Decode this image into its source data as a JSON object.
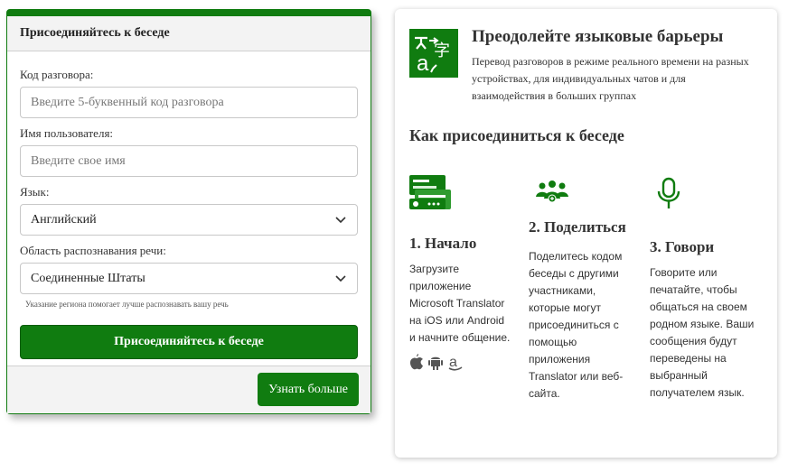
{
  "join": {
    "header_title": "Присоединяйтесь к беседе",
    "code_label": "Код разговора:",
    "code_placeholder": "Введите 5-буквенный код разговора",
    "name_label": "Имя пользователя:",
    "name_placeholder": "Введите свое имя",
    "language_label": "Язык:",
    "language_value": "Английский",
    "region_label": "Область распознавания речи:",
    "region_value": "Соединенные Штаты",
    "region_hint": "Указание региона помогает лучше распознавать вашу речь",
    "join_button": "Присоединяйтесь к беседе",
    "learn_more_button": "Узнать больше"
  },
  "info": {
    "title": "Преодолейте языковые барьеры",
    "subtitle": "Перевод разговоров в режиме реального времени на разных устройствах, для индивидуальных чатов и для взаимодействия в больших группах",
    "how_title": "Как присоединиться к беседе",
    "steps": [
      {
        "title": "1. Начало",
        "icon": "app-window-icon",
        "text": "Загрузите приложение Microsoft Translator на iOS или Android и начните общение."
      },
      {
        "title": "2. Поделиться",
        "icon": "people-add-icon",
        "text": "Поделитесь кодом беседы с другими участниками, которые могут присоединиться с помощью приложения Translator или веб-сайта."
      },
      {
        "title": "3. Говори",
        "icon": "microphone-icon",
        "text": "Говорите или печатайте, чтобы общаться на своем родном языке. Ваши сообщения будут переведены на выбранный получателем язык."
      }
    ],
    "platform_icons": [
      "apple-icon",
      "android-icon",
      "amazon-icon"
    ]
  },
  "colors": {
    "accent": "#107c10",
    "header_bg": "#f3f3f3"
  }
}
